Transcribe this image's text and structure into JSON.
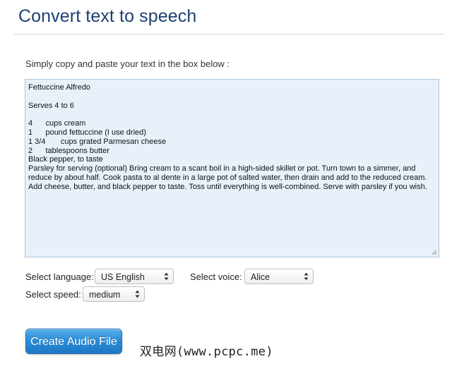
{
  "header": {
    "title": "Convert text to speech"
  },
  "form": {
    "instructions": "Simply copy and paste your text in the box below :",
    "text_value": "Fettuccine Alfredo\n\nServes 4 to 6\n\n4      cups cream\n1      pound fettuccine (I use dried)\n1 3/4       cups grated Parmesan cheese\n2      tablespoons butter\nBlack pepper, to taste\nParsley for serving (optional) Bring cream to a scant boil in a high-sided skillet or pot. Turn town to a simmer, and reduce by about half. Cook pasta to al dente in a large pot of salted water, then drain and add to the reduced cream. Add cheese, butter, and black pepper to taste. Toss until everything is well-combined. Serve with parsley if you wish.",
    "language_label": "Select language:",
    "language_value": "US English",
    "voice_label": "Select voice:",
    "voice_value": "Alice",
    "speed_label": "Select speed:",
    "speed_value": "medium",
    "create_button_label": "Create Audio File"
  },
  "watermark": {
    "text": "双电网(www.pcpc.me)"
  },
  "colors": {
    "title": "#1f3f73",
    "textarea_bg": "#e8f1fa",
    "textarea_border": "#a9c7e2",
    "button_top": "#56aee9",
    "button_bottom": "#1f78c4"
  }
}
